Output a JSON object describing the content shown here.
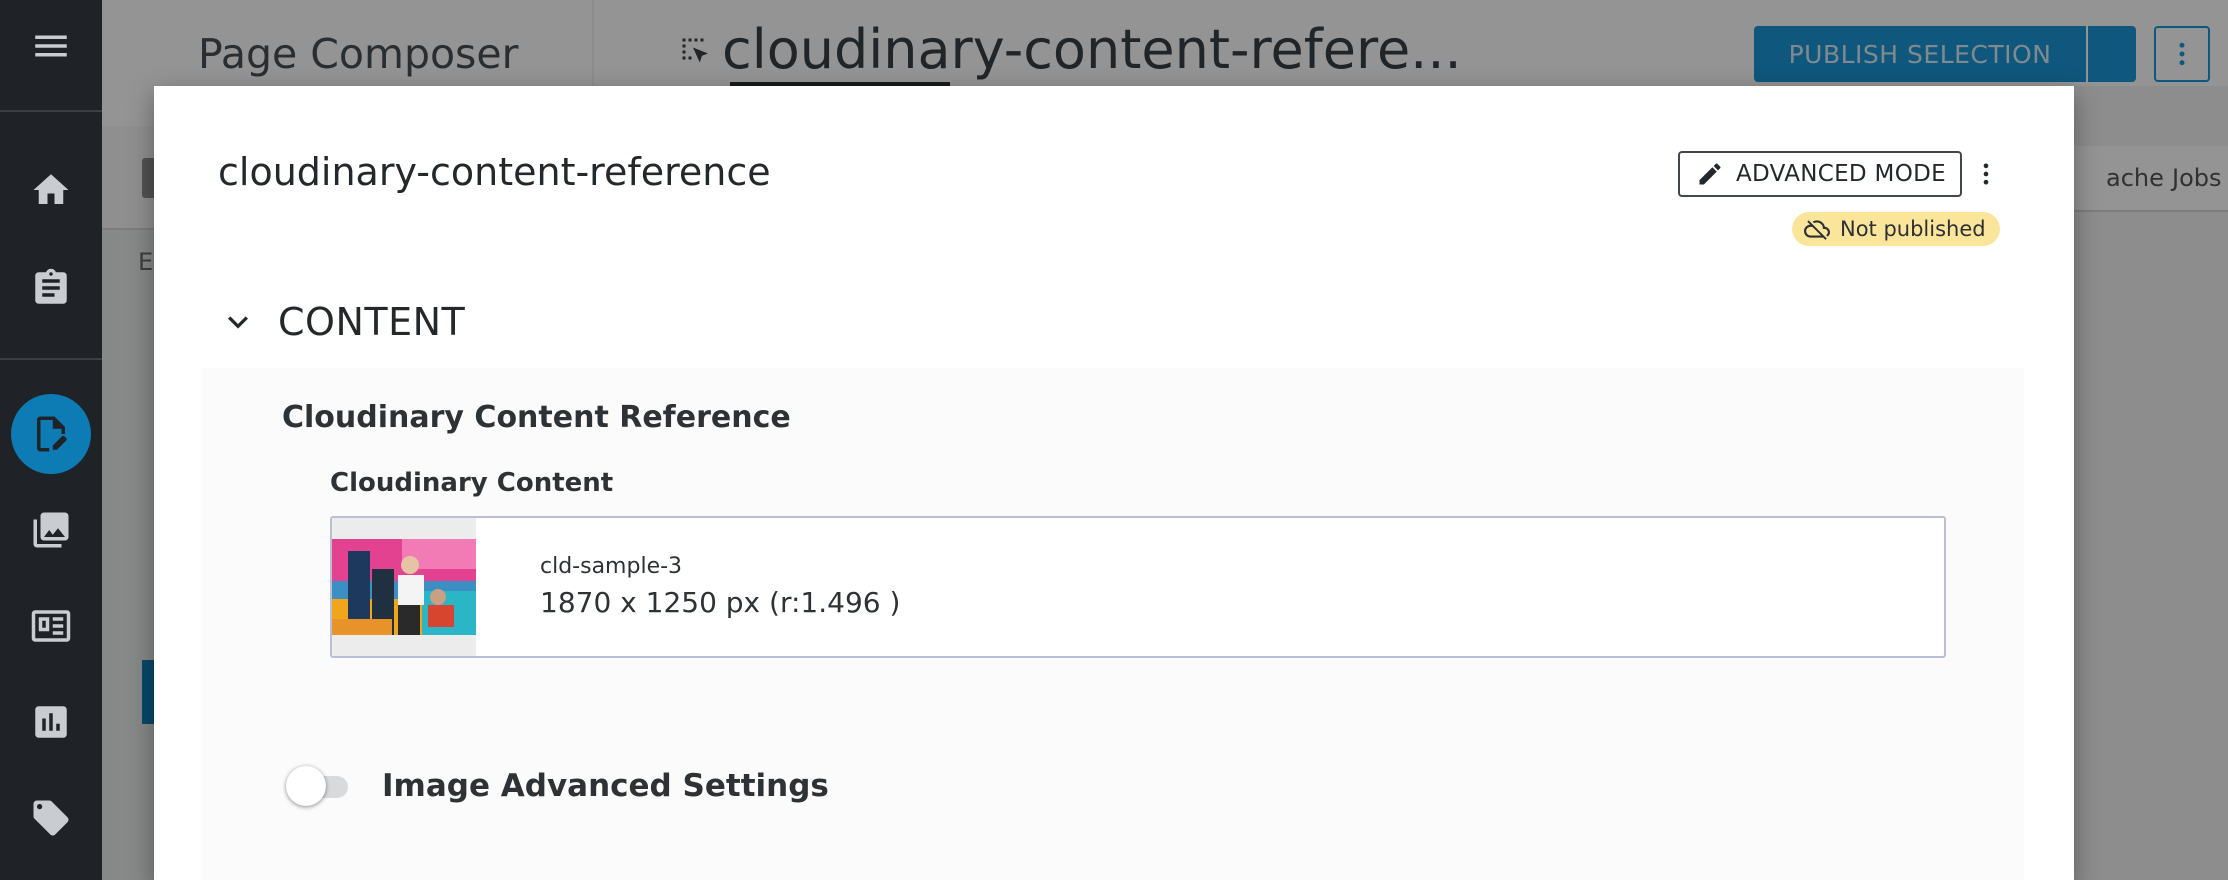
{
  "app": {
    "title": "Page Composer"
  },
  "rail": {
    "items": [
      {
        "icon": "menu-icon"
      },
      {
        "icon": "home-icon"
      },
      {
        "icon": "clipboard-icon"
      },
      {
        "icon": "page-edit-icon",
        "active": true
      },
      {
        "icon": "images-icon"
      },
      {
        "icon": "dashboard-icon"
      },
      {
        "icon": "bar-chart-icon"
      },
      {
        "icon": "tag-icon"
      }
    ]
  },
  "background": {
    "sidebar_row_letter": "E",
    "document_title": "cloudinary-content-refere...",
    "publish_label": "PUBLISH SELECTION",
    "tabs": {
      "cache": "ache",
      "jobs": "Jobs"
    }
  },
  "dialog": {
    "title": "cloudinary-content-reference",
    "advanced_mode_label": "ADVANCED MODE",
    "status": "Not published",
    "section_label": "CONTENT",
    "component_title": "Cloudinary Content Reference",
    "field_label": "Cloudinary Content",
    "asset": {
      "name": "cld-sample-3",
      "dimensions": "1870 x 1250 px (r:1.496 )"
    },
    "advanced_settings_label": "Image Advanced Settings",
    "advanced_settings_enabled": false
  },
  "colors": {
    "rail_bg": "#1f2327",
    "accent": "#0e7cb4",
    "publish_bg": "#1b97d6",
    "status_badge_bg": "#fbe59a"
  }
}
